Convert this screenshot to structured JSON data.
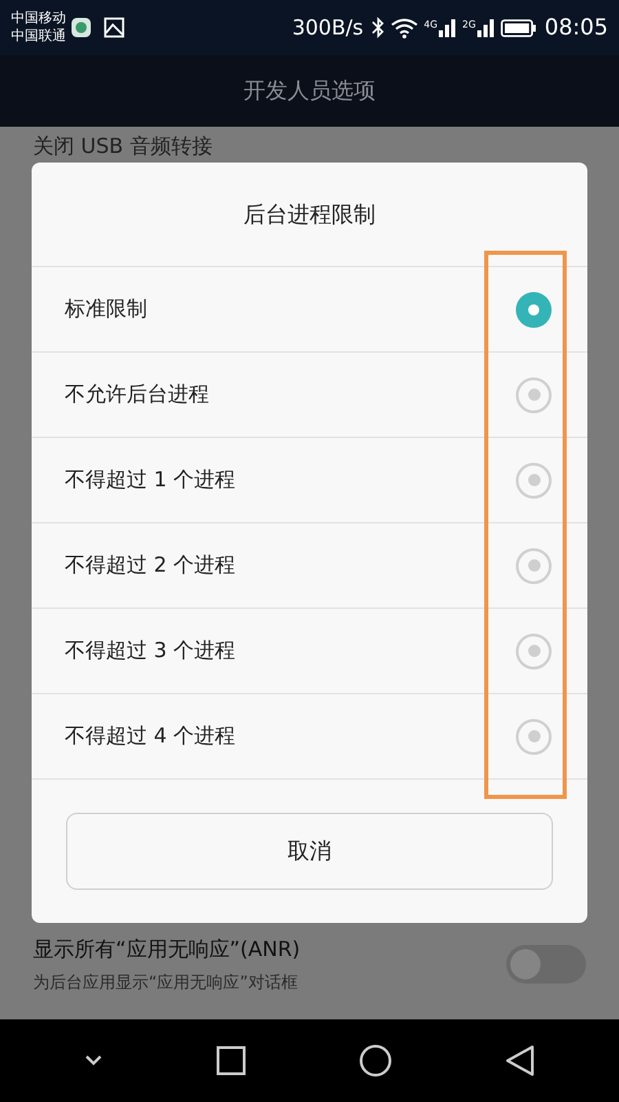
{
  "status_bar": {
    "carriers": [
      "中国移动",
      "中国联通"
    ],
    "speed": "300B/s",
    "network_labels": [
      "4G",
      "2G"
    ],
    "time": "08:05"
  },
  "title_bar": {
    "title": "开发人员选项"
  },
  "background": {
    "top_item": "关闭 USB 音频转接",
    "bottom_item": {
      "title": "显示所有“应用无响应”(ANR)",
      "subtitle": "为后台应用显示“应用无响应”对话框",
      "on": false
    }
  },
  "dialog": {
    "title": "后台进程限制",
    "options": [
      {
        "label": "标准限制",
        "selected": true
      },
      {
        "label": "不允许后台进程",
        "selected": false
      },
      {
        "label": "不得超过 1 个进程",
        "selected": false
      },
      {
        "label": "不得超过 2 个进程",
        "selected": false
      },
      {
        "label": "不得超过 3 个进程",
        "selected": false
      },
      {
        "label": "不得超过 4 个进程",
        "selected": false
      }
    ],
    "cancel": "取消",
    "highlight": true
  }
}
